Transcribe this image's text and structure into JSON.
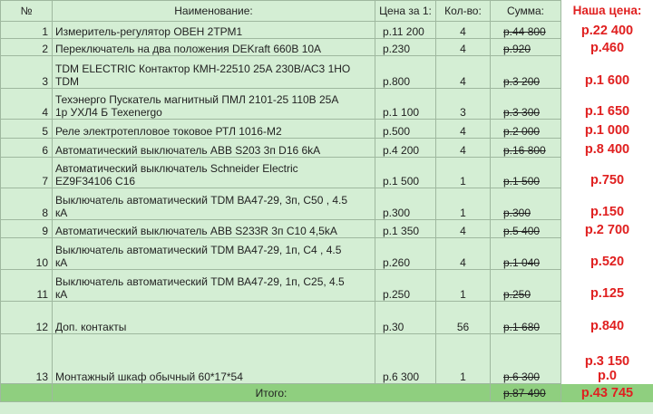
{
  "headers": {
    "num": "№",
    "name": "Наименование:",
    "price": "Цена за 1:",
    "qty": "Кол-во:",
    "sum": "Сумма:",
    "our": "Наша цена:"
  },
  "rows": [
    {
      "n": "1",
      "name1": "Измеритель-регулятор ОВЕН 2ТРМ1",
      "name2": "",
      "price": "р.11 200",
      "qty": "4",
      "sum": "р.44 800",
      "our": "р.22 400"
    },
    {
      "n": "2",
      "name1": "Переключатель на два положения DEKraft 660В 10А",
      "name2": "",
      "price": "р.230",
      "qty": "4",
      "sum": "р.920",
      "our": "р.460"
    },
    {
      "n": "3",
      "name1": "TDM ELECTRIC Контактор КМН-22510 25А 230В/АС3 1НО",
      "name2": "TDM",
      "price": "р.800",
      "qty": "4",
      "sum": "р.3 200",
      "our": "р.1 600"
    },
    {
      "n": "4",
      "name1": "Техэнерго Пускатель магнитный ПМЛ 2101-25 110В 25А",
      "name2": "1р УХЛ4 Б Техenergo",
      "price": "р.1 100",
      "qty": "3",
      "sum": "р.3 300",
      "our": "р.1 650"
    },
    {
      "n": "5",
      "name1": "Реле электротепловое токовое РТЛ 1016-М2",
      "name2": "",
      "price": "р.500",
      "qty": "4",
      "sum": "р.2 000",
      "our": "р.1 000"
    },
    {
      "n": "6",
      "name1": "Автоматический выключатель ABB S203 3п D16 6kA",
      "name2": "",
      "price": "р.4 200",
      "qty": "4",
      "sum": "р.16 800",
      "our": "р.8 400"
    },
    {
      "n": "7",
      "name1": "Автоматический выключатель Schneider Electric",
      "name2": "EZ9F34106 C16",
      "price": "р.1 500",
      "qty": "1",
      "sum": "р.1 500",
      "our": "р.750"
    },
    {
      "n": "8",
      "name1": "Выключатель автоматический TDM ВА47-29, 3п, С50 , 4.5",
      "name2": "кА",
      "price": "р.300",
      "qty": "1",
      "sum": "р.300",
      "our": "р.150"
    },
    {
      "n": "9",
      "name1": "Автоматический выключатель ABB S233R 3п C10 4,5kA",
      "name2": "",
      "price": "р.1 350",
      "qty": "4",
      "sum": "р.5 400",
      "our": "р.2 700"
    },
    {
      "n": "10",
      "name1": "Выключатель автоматический TDM ВА47-29, 1п, С4 , 4.5",
      "name2": "кА",
      "price": "р.260",
      "qty": "4",
      "sum": "р.1 040",
      "our": "р.520"
    },
    {
      "n": "11",
      "name1": "Выключатель автоматический TDM ВА47-29, 1п, С25, 4.5",
      "name2": "кА",
      "price": "р.250",
      "qty": "1",
      "sum": "р.250",
      "our": "р.125"
    },
    {
      "n": "12",
      "name1": "Доп. контакты",
      "name2": "",
      "price": "р.30",
      "qty": "56",
      "sum": "р.1 680",
      "our": "р.840"
    },
    {
      "n": "13",
      "name1": "Монтажный шкаф обычный 60*17*54",
      "name2": "",
      "price": "р.6 300",
      "qty": "1",
      "sum": "р.6 300",
      "our1": "р.3 150",
      "our2": "р.0"
    }
  ],
  "total": {
    "label": "Итого:",
    "sum": "р.87 490",
    "our": "р.43 745"
  }
}
